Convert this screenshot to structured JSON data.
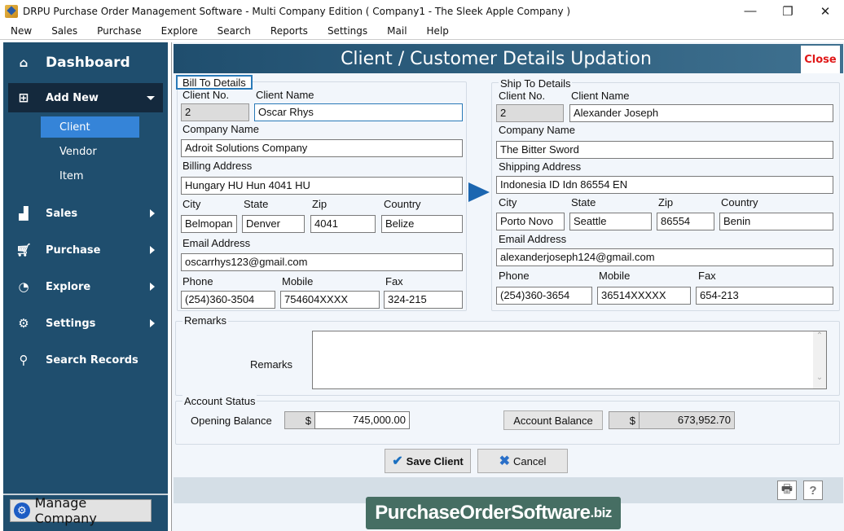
{
  "window": {
    "title": "DRPU Purchase Order Management Software - Multi Company Edition ( Company1 - The Sleek Apple Company )",
    "minimize": "—",
    "restore": "❐",
    "close": "✕"
  },
  "menu": [
    "New",
    "Sales",
    "Purchase",
    "Explore",
    "Search",
    "Reports",
    "Settings",
    "Mail",
    "Help"
  ],
  "sidebar": {
    "dashboard": "Dashboard",
    "add_new": "Add New",
    "sub_items": [
      "Client",
      "Vendor",
      "Item"
    ],
    "active_sub": "Client",
    "items": [
      {
        "label": "Sales",
        "icon": "chart-icon"
      },
      {
        "label": "Purchase",
        "icon": "cart-icon"
      },
      {
        "label": "Explore",
        "icon": "pie-chart-icon"
      },
      {
        "label": "Settings",
        "icon": "gear-icon"
      },
      {
        "label": "Search Records",
        "icon": "search-icon"
      }
    ],
    "manage_company": "Manage Company"
  },
  "header": {
    "title": "Client / Customer Details Updation",
    "close": "Close"
  },
  "bill_to": {
    "legend": "Bill To Details",
    "labels": {
      "client_no": "Client No.",
      "client_name": "Client Name",
      "company_name": "Company Name",
      "address": "Billing Address",
      "city": "City",
      "state": "State",
      "zip": "Zip",
      "country": "Country",
      "email": "Email Address",
      "phone": "Phone",
      "mobile": "Mobile",
      "fax": "Fax"
    },
    "values": {
      "client_no": "2",
      "client_name": "Oscar Rhys",
      "company_name": "Adroit Solutions Company",
      "address": "Hungary HU Hun 4041 HU",
      "city": "Belmopan",
      "state": "Denver",
      "zip": "4041",
      "country": "Belize",
      "email": "oscarrhys123@gmail.com",
      "phone": "(254)360-3504",
      "mobile": "754604XXXX",
      "fax": "324-215"
    }
  },
  "ship_to": {
    "legend": "Ship To Details",
    "labels": {
      "client_no": "Client No.",
      "client_name": "Client Name",
      "company_name": "Company Name",
      "address": "Shipping Address",
      "city": "City",
      "state": "State",
      "zip": "Zip",
      "country": "Country",
      "email": "Email Address",
      "phone": "Phone",
      "mobile": "Mobile",
      "fax": "Fax"
    },
    "values": {
      "client_no": "2",
      "client_name": "Alexander Joseph",
      "company_name": "The Bitter Sword",
      "address": "Indonesia ID Idn 86554 EN",
      "city": "Porto Novo",
      "state": "Seattle",
      "zip": "86554",
      "country": "Benin",
      "email": "alexanderjoseph124@gmail.com",
      "phone": "(254)360-3654",
      "mobile": "36514XXXXX",
      "fax": "654-213"
    }
  },
  "remarks": {
    "legend": "Remarks",
    "label": "Remarks",
    "value": ""
  },
  "account": {
    "legend": "Account Status",
    "opening_label": "Opening Balance",
    "currency": "$",
    "opening_value": "745,000.00",
    "balance_button": "Account Balance",
    "balance_value": "673,952.70"
  },
  "actions": {
    "save": "Save Client",
    "cancel": "Cancel"
  },
  "brand": {
    "main": "PurchaseOrderSoftware",
    "suffix": ".biz"
  }
}
